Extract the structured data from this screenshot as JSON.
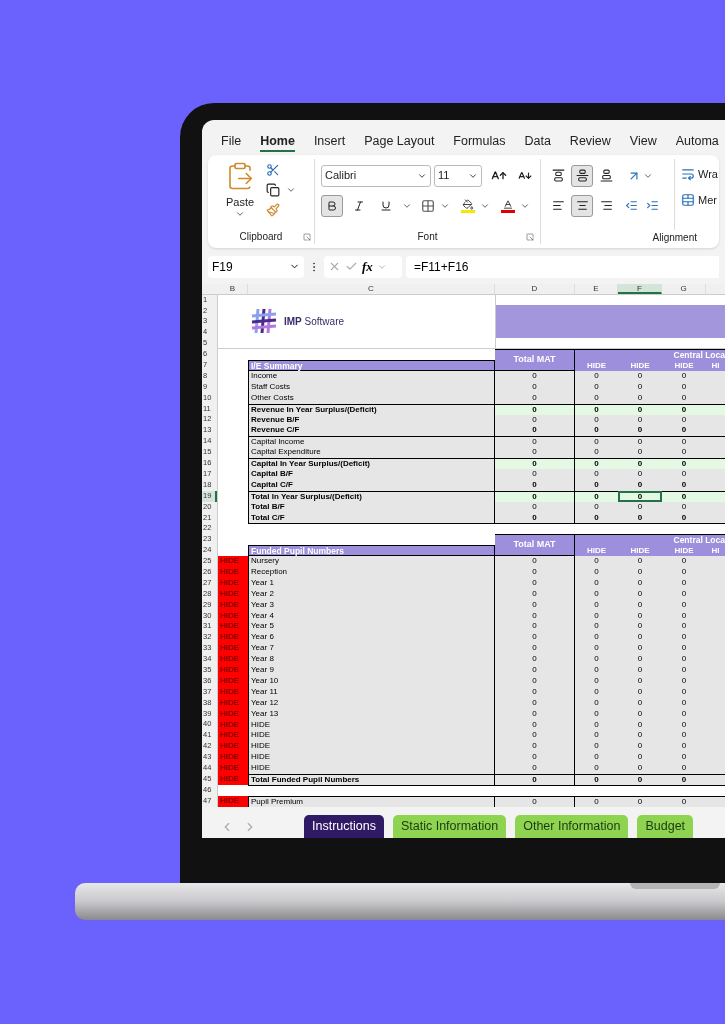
{
  "menu_tabs": [
    {
      "label": "File",
      "selected": false
    },
    {
      "label": "Home",
      "selected": true
    },
    {
      "label": "Insert",
      "selected": false
    },
    {
      "label": "Page Layout",
      "selected": false
    },
    {
      "label": "Formulas",
      "selected": false
    },
    {
      "label": "Data",
      "selected": false
    },
    {
      "label": "Review",
      "selected": false
    },
    {
      "label": "View",
      "selected": false
    },
    {
      "label": "Automa",
      "selected": false
    }
  ],
  "ribbon": {
    "clipboard": {
      "label": "Clipboard",
      "paste": "Paste"
    },
    "font": {
      "label": "Font",
      "family": "Calibri",
      "size": "11",
      "bold": true,
      "italic": false,
      "underline": false
    },
    "alignment": {
      "label": "Alignment",
      "vertical": [
        {
          "kind": "top",
          "selected": false
        },
        {
          "kind": "middle",
          "selected": true
        },
        {
          "kind": "bottom",
          "selected": false
        }
      ],
      "horizontal": [
        {
          "kind": "left",
          "selected": false
        },
        {
          "kind": "center",
          "selected": true
        },
        {
          "kind": "right",
          "selected": false
        }
      ],
      "wrap": "Wra",
      "merge": "Mer"
    }
  },
  "formula_bar": {
    "name_box": "F19",
    "function_label": "fx",
    "formula": "=F11+F16"
  },
  "columns": [
    {
      "label": "B",
      "selected": false
    },
    {
      "label": "C",
      "selected": false
    },
    {
      "label": "D",
      "selected": false
    },
    {
      "label": "E",
      "selected": false
    },
    {
      "label": "F",
      "selected": true
    },
    {
      "label": "G",
      "selected": false
    }
  ],
  "row_headers": [
    {
      "label": "1",
      "selected": false
    },
    {
      "label": "2",
      "selected": false
    },
    {
      "label": "3",
      "selected": false
    },
    {
      "label": "4",
      "selected": false
    },
    {
      "label": "5",
      "selected": false
    },
    {
      "label": "6",
      "selected": false
    },
    {
      "label": "7",
      "selected": false
    },
    {
      "label": "8",
      "selected": false
    },
    {
      "label": "9",
      "selected": false
    },
    {
      "label": "10",
      "selected": false
    },
    {
      "label": "11",
      "selected": false
    },
    {
      "label": "12",
      "selected": false
    },
    {
      "label": "13",
      "selected": false
    },
    {
      "label": "14",
      "selected": false
    },
    {
      "label": "15",
      "selected": false
    },
    {
      "label": "16",
      "selected": false
    },
    {
      "label": "17",
      "selected": false
    },
    {
      "label": "18",
      "selected": false
    },
    {
      "label": "19",
      "selected": true
    },
    {
      "label": "20",
      "selected": false
    },
    {
      "label": "21",
      "selected": false
    },
    {
      "label": "22",
      "selected": false
    },
    {
      "label": "23",
      "selected": false
    },
    {
      "label": "24",
      "selected": false
    },
    {
      "label": "25",
      "selected": false
    },
    {
      "label": "26",
      "selected": false
    },
    {
      "label": "27",
      "selected": false
    },
    {
      "label": "28",
      "selected": false
    },
    {
      "label": "29",
      "selected": false
    },
    {
      "label": "30",
      "selected": false
    },
    {
      "label": "31",
      "selected": false
    },
    {
      "label": "32",
      "selected": false
    },
    {
      "label": "33",
      "selected": false
    },
    {
      "label": "34",
      "selected": false
    },
    {
      "label": "35",
      "selected": false
    },
    {
      "label": "36",
      "selected": false
    },
    {
      "label": "37",
      "selected": false
    },
    {
      "label": "38",
      "selected": false
    },
    {
      "label": "39",
      "selected": false
    },
    {
      "label": "40",
      "selected": false
    },
    {
      "label": "41",
      "selected": false
    },
    {
      "label": "42",
      "selected": false
    },
    {
      "label": "43",
      "selected": false
    },
    {
      "label": "44",
      "selected": false
    },
    {
      "label": "45",
      "selected": false
    },
    {
      "label": "46",
      "selected": false
    },
    {
      "label": "47",
      "selected": false
    }
  ],
  "logo": {
    "text": "**IMP** Software"
  },
  "tables": [
    {
      "title": "I/E Summary",
      "total_header": "Total MAT",
      "group_header": "Central Loca",
      "subheaders": [
        "HIDE",
        "HIDE",
        "HIDE",
        "HI"
      ],
      "rows": [
        {
          "label": "Income",
          "bold": false,
          "values_bold": false,
          "highlight": false,
          "rule_above": false,
          "cells": [
            {
              "text": "0",
              "selected": false
            },
            {
              "text": "0",
              "selected": false
            },
            {
              "text": "0",
              "selected": false
            },
            {
              "text": "0",
              "selected": false
            }
          ]
        },
        {
          "label": "Staff Costs",
          "bold": false,
          "values_bold": false,
          "highlight": false,
          "rule_above": false,
          "cells": [
            {
              "text": "0",
              "selected": false
            },
            {
              "text": "0",
              "selected": false
            },
            {
              "text": "0",
              "selected": false
            },
            {
              "text": "0",
              "selected": false
            }
          ]
        },
        {
          "label": "Other Costs",
          "bold": false,
          "values_bold": false,
          "highlight": false,
          "rule_above": false,
          "cells": [
            {
              "text": "0",
              "selected": false
            },
            {
              "text": "0",
              "selected": false
            },
            {
              "text": "0",
              "selected": false
            },
            {
              "text": "0",
              "selected": false
            }
          ]
        },
        {
          "label": "Revenue In Year Surplus/(Deficit)",
          "bold": true,
          "values_bold": true,
          "highlight": true,
          "rule_above": true,
          "cells": [
            {
              "text": "0",
              "selected": false
            },
            {
              "text": "0",
              "selected": false
            },
            {
              "text": "0",
              "selected": false
            },
            {
              "text": "0",
              "selected": false
            }
          ]
        },
        {
          "label": "Revenue B/F",
          "bold": true,
          "values_bold": false,
          "highlight": false,
          "rule_above": false,
          "cells": [
            {
              "text": "0",
              "selected": false
            },
            {
              "text": "0",
              "selected": false
            },
            {
              "text": "0",
              "selected": false
            },
            {
              "text": "0",
              "selected": false
            }
          ]
        },
        {
          "label": "Revenue C/F",
          "bold": true,
          "values_bold": true,
          "highlight": false,
          "rule_above": false,
          "cells": [
            {
              "text": "0",
              "selected": false
            },
            {
              "text": "0",
              "selected": false
            },
            {
              "text": "0",
              "selected": false
            },
            {
              "text": "0",
              "selected": false
            }
          ]
        },
        {
          "label": "Capital Income",
          "bold": false,
          "values_bold": false,
          "highlight": false,
          "rule_above": true,
          "cells": [
            {
              "text": "0",
              "selected": false
            },
            {
              "text": "0",
              "selected": false
            },
            {
              "text": "0",
              "selected": false
            },
            {
              "text": "0",
              "selected": false
            }
          ]
        },
        {
          "label": "Capital Expenditure",
          "bold": false,
          "values_bold": false,
          "highlight": false,
          "rule_above": false,
          "cells": [
            {
              "text": "0",
              "selected": false
            },
            {
              "text": "0",
              "selected": false
            },
            {
              "text": "0",
              "selected": false
            },
            {
              "text": "0",
              "selected": false
            }
          ]
        },
        {
          "label": "Capital In Year Surplus/(Deficit)",
          "bold": true,
          "values_bold": true,
          "highlight": true,
          "rule_above": true,
          "cells": [
            {
              "text": "0",
              "selected": false
            },
            {
              "text": "0",
              "selected": false
            },
            {
              "text": "0",
              "selected": false
            },
            {
              "text": "0",
              "selected": false
            }
          ]
        },
        {
          "label": "Capital B/F",
          "bold": true,
          "values_bold": false,
          "highlight": false,
          "rule_above": false,
          "cells": [
            {
              "text": "0",
              "selected": false
            },
            {
              "text": "0",
              "selected": false
            },
            {
              "text": "0",
              "selected": false
            },
            {
              "text": "0",
              "selected": false
            }
          ]
        },
        {
          "label": "Capital C/F",
          "bold": true,
          "values_bold": true,
          "highlight": false,
          "rule_above": false,
          "cells": [
            {
              "text": "0",
              "selected": false
            },
            {
              "text": "0",
              "selected": false
            },
            {
              "text": "0",
              "selected": false
            },
            {
              "text": "0",
              "selected": false
            }
          ]
        },
        {
          "label": "Total In Year Surplus/(Deficit)",
          "bold": true,
          "values_bold": true,
          "highlight": true,
          "rule_above": true,
          "cells": [
            {
              "text": "0",
              "selected": false
            },
            {
              "text": "0",
              "selected": false
            },
            {
              "text": "0",
              "selected": true
            },
            {
              "text": "0",
              "selected": false
            }
          ]
        },
        {
          "label": "Total B/F",
          "bold": true,
          "values_bold": false,
          "highlight": false,
          "rule_above": false,
          "cells": [
            {
              "text": "0",
              "selected": false
            },
            {
              "text": "0",
              "selected": false
            },
            {
              "text": "0",
              "selected": false
            },
            {
              "text": "0",
              "selected": false
            }
          ]
        },
        {
          "label": "Total C/F",
          "bold": true,
          "values_bold": true,
          "highlight": false,
          "rule_above": false,
          "cells": [
            {
              "text": "0",
              "selected": false
            },
            {
              "text": "0",
              "selected": false
            },
            {
              "text": "0",
              "selected": false
            },
            {
              "text": "0",
              "selected": false
            }
          ]
        }
      ]
    },
    {
      "title": "Funded Pupil Numbers",
      "total_header": "Total MAT",
      "group_header": "Central Loca",
      "subheaders": [
        "HIDE",
        "HIDE",
        "HIDE",
        "HI"
      ],
      "rows": [
        {
          "flag": "HIDE",
          "label": "Nursery",
          "bold": false,
          "values_bold": false,
          "highlight": false,
          "rule_above": false,
          "cells": [
            {
              "text": "0",
              "selected": false
            },
            {
              "text": "0",
              "selected": false
            },
            {
              "text": "0",
              "selected": false
            },
            {
              "text": "0",
              "selected": false
            }
          ]
        },
        {
          "flag": "HIDE",
          "label": "Reception",
          "bold": false,
          "values_bold": false,
          "highlight": false,
          "rule_above": false,
          "cells": [
            {
              "text": "0",
              "selected": false
            },
            {
              "text": "0",
              "selected": false
            },
            {
              "text": "0",
              "selected": false
            },
            {
              "text": "0",
              "selected": false
            }
          ]
        },
        {
          "flag": "HIDE",
          "label": "Year 1",
          "bold": false,
          "values_bold": false,
          "highlight": false,
          "rule_above": false,
          "cells": [
            {
              "text": "0",
              "selected": false
            },
            {
              "text": "0",
              "selected": false
            },
            {
              "text": "0",
              "selected": false
            },
            {
              "text": "0",
              "selected": false
            }
          ]
        },
        {
          "flag": "HIDE",
          "label": "Year 2",
          "bold": false,
          "values_bold": false,
          "highlight": false,
          "rule_above": false,
          "cells": [
            {
              "text": "0",
              "selected": false
            },
            {
              "text": "0",
              "selected": false
            },
            {
              "text": "0",
              "selected": false
            },
            {
              "text": "0",
              "selected": false
            }
          ]
        },
        {
          "flag": "HIDE",
          "label": "Year 3",
          "bold": false,
          "values_bold": false,
          "highlight": false,
          "rule_above": false,
          "cells": [
            {
              "text": "0",
              "selected": false
            },
            {
              "text": "0",
              "selected": false
            },
            {
              "text": "0",
              "selected": false
            },
            {
              "text": "0",
              "selected": false
            }
          ]
        },
        {
          "flag": "HIDE",
          "label": "Year 4",
          "bold": false,
          "values_bold": false,
          "highlight": false,
          "rule_above": false,
          "cells": [
            {
              "text": "0",
              "selected": false
            },
            {
              "text": "0",
              "selected": false
            },
            {
              "text": "0",
              "selected": false
            },
            {
              "text": "0",
              "selected": false
            }
          ]
        },
        {
          "flag": "HIDE",
          "label": "Year 5",
          "bold": false,
          "values_bold": false,
          "highlight": false,
          "rule_above": false,
          "cells": [
            {
              "text": "0",
              "selected": false
            },
            {
              "text": "0",
              "selected": false
            },
            {
              "text": "0",
              "selected": false
            },
            {
              "text": "0",
              "selected": false
            }
          ]
        },
        {
          "flag": "HIDE",
          "label": "Year 6",
          "bold": false,
          "values_bold": false,
          "highlight": false,
          "rule_above": false,
          "cells": [
            {
              "text": "0",
              "selected": false
            },
            {
              "text": "0",
              "selected": false
            },
            {
              "text": "0",
              "selected": false
            },
            {
              "text": "0",
              "selected": false
            }
          ]
        },
        {
          "flag": "HIDE",
          "label": "Year 7",
          "bold": false,
          "values_bold": false,
          "highlight": false,
          "rule_above": false,
          "cells": [
            {
              "text": "0",
              "selected": false
            },
            {
              "text": "0",
              "selected": false
            },
            {
              "text": "0",
              "selected": false
            },
            {
              "text": "0",
              "selected": false
            }
          ]
        },
        {
          "flag": "HIDE",
          "label": "Year 8",
          "bold": false,
          "values_bold": false,
          "highlight": false,
          "rule_above": false,
          "cells": [
            {
              "text": "0",
              "selected": false
            },
            {
              "text": "0",
              "selected": false
            },
            {
              "text": "0",
              "selected": false
            },
            {
              "text": "0",
              "selected": false
            }
          ]
        },
        {
          "flag": "HIDE",
          "label": "Year 9",
          "bold": false,
          "values_bold": false,
          "highlight": false,
          "rule_above": false,
          "cells": [
            {
              "text": "0",
              "selected": false
            },
            {
              "text": "0",
              "selected": false
            },
            {
              "text": "0",
              "selected": false
            },
            {
              "text": "0",
              "selected": false
            }
          ]
        },
        {
          "flag": "HIDE",
          "label": "Year 10",
          "bold": false,
          "values_bold": false,
          "highlight": false,
          "rule_above": false,
          "cells": [
            {
              "text": "0",
              "selected": false
            },
            {
              "text": "0",
              "selected": false
            },
            {
              "text": "0",
              "selected": false
            },
            {
              "text": "0",
              "selected": false
            }
          ]
        },
        {
          "flag": "HIDE",
          "label": "Year 11",
          "bold": false,
          "values_bold": false,
          "highlight": false,
          "rule_above": false,
          "cells": [
            {
              "text": "0",
              "selected": false
            },
            {
              "text": "0",
              "selected": false
            },
            {
              "text": "0",
              "selected": false
            },
            {
              "text": "0",
              "selected": false
            }
          ]
        },
        {
          "flag": "HIDE",
          "label": "Year 12",
          "bold": false,
          "values_bold": false,
          "highlight": false,
          "rule_above": false,
          "cells": [
            {
              "text": "0",
              "selected": false
            },
            {
              "text": "0",
              "selected": false
            },
            {
              "text": "0",
              "selected": false
            },
            {
              "text": "0",
              "selected": false
            }
          ]
        },
        {
          "flag": "HIDE",
          "label": "Year 13",
          "bold": false,
          "values_bold": false,
          "highlight": false,
          "rule_above": false,
          "cells": [
            {
              "text": "0",
              "selected": false
            },
            {
              "text": "0",
              "selected": false
            },
            {
              "text": "0",
              "selected": false
            },
            {
              "text": "0",
              "selected": false
            }
          ]
        },
        {
          "flag": "HIDE",
          "label": "HIDE",
          "bold": false,
          "values_bold": false,
          "highlight": false,
          "rule_above": false,
          "cells": [
            {
              "text": "0",
              "selected": false
            },
            {
              "text": "0",
              "selected": false
            },
            {
              "text": "0",
              "selected": false
            },
            {
              "text": "0",
              "selected": false
            }
          ]
        },
        {
          "flag": "HIDE",
          "label": "HIDE",
          "bold": false,
          "values_bold": false,
          "highlight": false,
          "rule_above": false,
          "cells": [
            {
              "text": "0",
              "selected": false
            },
            {
              "text": "0",
              "selected": false
            },
            {
              "text": "0",
              "selected": false
            },
            {
              "text": "0",
              "selected": false
            }
          ]
        },
        {
          "flag": "HIDE",
          "label": "HIDE",
          "bold": false,
          "values_bold": false,
          "highlight": false,
          "rule_above": false,
          "cells": [
            {
              "text": "0",
              "selected": false
            },
            {
              "text": "0",
              "selected": false
            },
            {
              "text": "0",
              "selected": false
            },
            {
              "text": "0",
              "selected": false
            }
          ]
        },
        {
          "flag": "HIDE",
          "label": "HIDE",
          "bold": false,
          "values_bold": false,
          "highlight": false,
          "rule_above": false,
          "cells": [
            {
              "text": "0",
              "selected": false
            },
            {
              "text": "0",
              "selected": false
            },
            {
              "text": "0",
              "selected": false
            },
            {
              "text": "0",
              "selected": false
            }
          ]
        },
        {
          "flag": "HIDE",
          "label": "HIDE",
          "bold": false,
          "values_bold": false,
          "highlight": false,
          "rule_above": false,
          "cells": [
            {
              "text": "0",
              "selected": false
            },
            {
              "text": "0",
              "selected": false
            },
            {
              "text": "0",
              "selected": false
            },
            {
              "text": "0",
              "selected": false
            }
          ]
        },
        {
          "flag": "HIDE",
          "label": "Total Funded Pupil Numbers",
          "bold": true,
          "values_bold": true,
          "highlight": false,
          "rule_above": true,
          "cells": [
            {
              "text": "0",
              "selected": false
            },
            {
              "text": "0",
              "selected": false
            },
            {
              "text": "0",
              "selected": false
            },
            {
              "text": "0",
              "selected": false
            }
          ]
        }
      ]
    }
  ],
  "extra_rows": [
    {
      "flag": "HIDE",
      "label": "Pupil Premium",
      "bold": false,
      "values_bold": false,
      "highlight": false,
      "rule_above": true,
      "cells": [
        {
          "text": "0",
          "selected": false
        },
        {
          "text": "0",
          "selected": false
        },
        {
          "text": "0",
          "selected": false
        },
        {
          "text": "0",
          "selected": false
        }
      ]
    }
  ],
  "sheet_tabs": [
    {
      "label": "Instructions",
      "selected": true,
      "color": "#2f1a66"
    },
    {
      "label": "Static Information",
      "selected": false,
      "color": "#8fd451"
    },
    {
      "label": "Other Information",
      "selected": false,
      "color": "#8fd451"
    },
    {
      "label": "Budget",
      "selected": false,
      "color": "#8fd451"
    }
  ]
}
